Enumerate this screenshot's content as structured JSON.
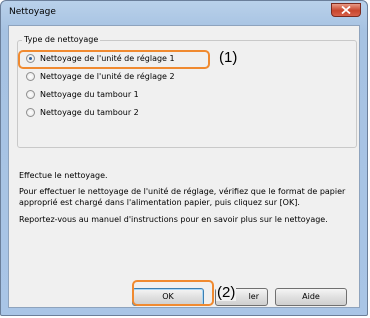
{
  "window": {
    "title": "Nettoyage"
  },
  "group": {
    "legend": "Type de nettoyage",
    "options": [
      {
        "label": "Nettoyage de l'unité de réglage 1",
        "checked": true
      },
      {
        "label": "Nettoyage de l'unité de réglage 2",
        "checked": false
      },
      {
        "label": "Nettoyage du tambour 1",
        "checked": false
      },
      {
        "label": "Nettoyage du tambour 2",
        "checked": false
      }
    ]
  },
  "info": {
    "heading": "Effectue le nettoyage.",
    "body": "Pour effectuer le nettoyage de l'unité de réglage, vérifiez que le format de papier approprié est chargé dans l'alimentation papier, puis cliquez sur [OK].",
    "reference": "Reportez-vous au manuel d'instructions pour en savoir plus sur le nettoyage."
  },
  "buttons": {
    "ok": "OK",
    "cancel": "ler",
    "help": "Aide"
  },
  "callouts": {
    "one": "(1)",
    "two": "(2)"
  },
  "colors": {
    "callout": "#f08a30",
    "titlebar": "#b9d1ea",
    "close": "#c8452c"
  }
}
